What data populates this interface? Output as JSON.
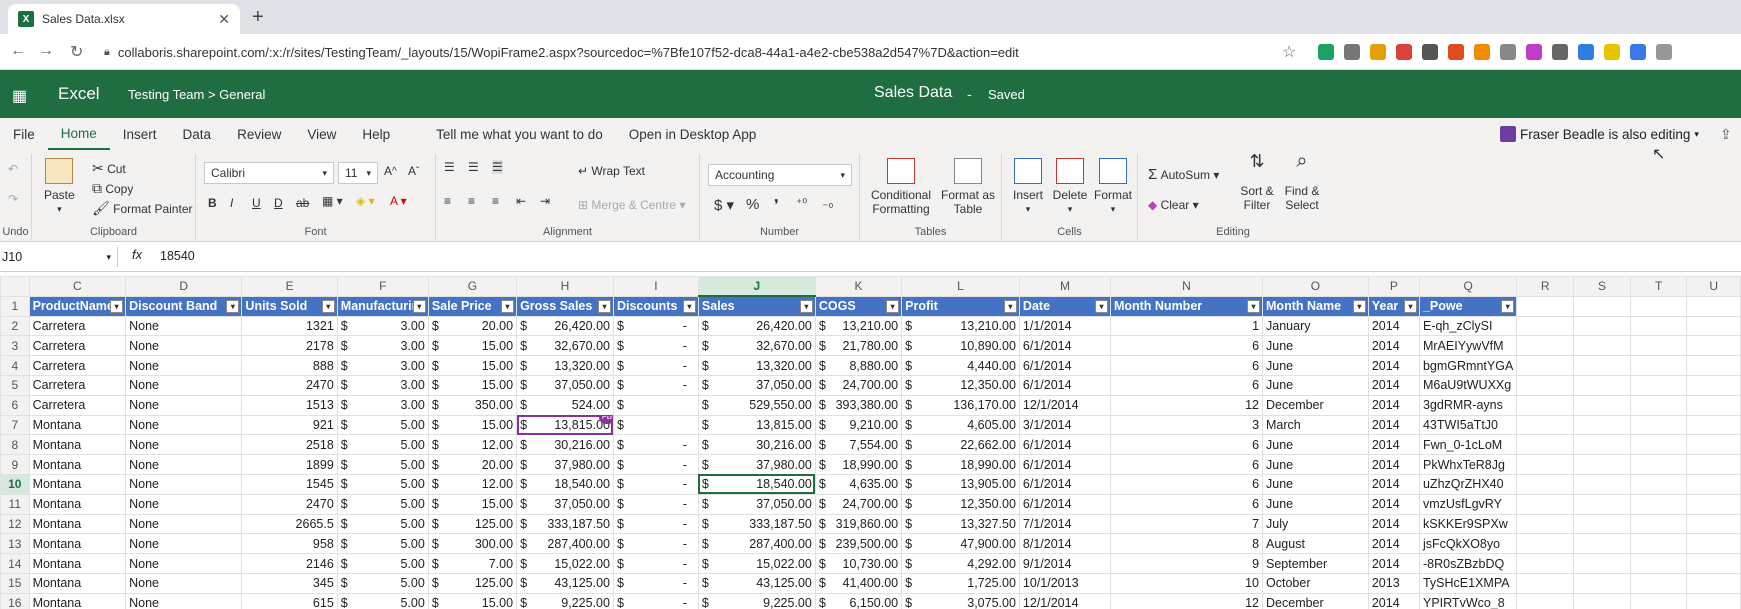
{
  "browser": {
    "tab_title": "Sales Data.xlsx",
    "tab_icon": "X",
    "url": "collaboris.sharepoint.com/:x:/r/sites/TestingTeam/_layouts/15/WopiFrame2.aspx?sourcedoc=%7Bfe107f52-dca8-44a1-a4e2-cbe538a2d547%7D&action=edit"
  },
  "excel": {
    "app_name": "Excel",
    "breadcrumb": "Testing Team  >  General",
    "doc_title": "Sales Data",
    "separator": "-",
    "status": "Saved",
    "tabs": [
      "File",
      "Home",
      "Insert",
      "Data",
      "Review",
      "View",
      "Help",
      "Tell me what you want to do",
      "Open in Desktop App"
    ],
    "coauthor": "Fraser Beadle is also editing"
  },
  "ribbon": {
    "undo_label": "Undo",
    "paste": "Paste",
    "cut": "Cut",
    "copy": "Copy",
    "format_painter": "Format Painter",
    "clipboard_label": "Clipboard",
    "font_name": "Calibri",
    "font_size": "11",
    "font_label": "Font",
    "wrap_text": "Wrap Text",
    "merge_centre": "Merge & Centre",
    "alignment_label": "Alignment",
    "number_format": "Accounting",
    "number_label": "Number",
    "conditional_formatting": "Conditional Formatting",
    "format_as_table": "Format as Table",
    "tables_label": "Tables",
    "insert": "Insert",
    "delete": "Delete",
    "format": "Format",
    "cells_label": "Cells",
    "autosum": "AutoSum",
    "clear": "Clear",
    "sort_filter": "Sort & Filter",
    "find_select": "Find & Select",
    "editing_label": "Editing"
  },
  "formula": {
    "name_box": "J10",
    "fx": "fx",
    "value": "18540"
  },
  "grid": {
    "columns": [
      "C",
      "D",
      "E",
      "F",
      "G",
      "H",
      "I",
      "J",
      "K",
      "L",
      "M",
      "N",
      "O",
      "P",
      "Q",
      "R",
      "S",
      "T",
      "U"
    ],
    "headers": [
      "ProductName",
      "Discount Band",
      "Units Sold",
      "Manufacturin",
      "Sale Price",
      "Gross Sales",
      "Discounts",
      "Sales",
      "COGS",
      "Profit",
      "Date",
      "Month Number",
      "Month Name",
      "Year",
      "_Powe"
    ],
    "rows": [
      {
        "n": "2",
        "c": [
          "Carretera",
          "None",
          "1321",
          "3.00",
          "20.00",
          "26,420.00",
          "-",
          "26,420.00",
          "13,210.00",
          "13,210.00",
          "1/1/2014",
          "1",
          "January",
          "2014",
          "E-qh_zClySI"
        ]
      },
      {
        "n": "3",
        "c": [
          "Carretera",
          "None",
          "2178",
          "3.00",
          "15.00",
          "32,670.00",
          "-",
          "32,670.00",
          "21,780.00",
          "10,890.00",
          "6/1/2014",
          "6",
          "June",
          "2014",
          "MrAEIYywVfM"
        ]
      },
      {
        "n": "4",
        "c": [
          "Carretera",
          "None",
          "888",
          "3.00",
          "15.00",
          "13,320.00",
          "-",
          "13,320.00",
          "8,880.00",
          "4,440.00",
          "6/1/2014",
          "6",
          "June",
          "2014",
          "bgmGRmntYGA"
        ]
      },
      {
        "n": "5",
        "c": [
          "Carretera",
          "None",
          "2470",
          "3.00",
          "15.00",
          "37,050.00",
          "-",
          "37,050.00",
          "24,700.00",
          "12,350.00",
          "6/1/2014",
          "6",
          "June",
          "2014",
          "M6aU9tWUXXg"
        ]
      },
      {
        "n": "6",
        "c": [
          "Carretera",
          "None",
          "1513",
          "3.00",
          "350.00",
          "524.00",
          "",
          "529,550.00",
          "393,380.00",
          "136,170.00",
          "12/1/2014",
          "12",
          "December",
          "2014",
          "3gdRMR-ayns"
        ]
      },
      {
        "n": "7",
        "c": [
          "Montana",
          "None",
          "921",
          "5.00",
          "15.00",
          "13,815.00",
          "",
          "13,815.00",
          "9,210.00",
          "4,605.00",
          "3/1/2014",
          "3",
          "March",
          "2014",
          "43TWI5aTtJ0"
        ]
      },
      {
        "n": "8",
        "c": [
          "Montana",
          "None",
          "2518",
          "5.00",
          "12.00",
          "30,216.00",
          "-",
          "30,216.00",
          "7,554.00",
          "22,662.00",
          "6/1/2014",
          "6",
          "June",
          "2014",
          "Fwn_0-1cLoM"
        ]
      },
      {
        "n": "9",
        "c": [
          "Montana",
          "None",
          "1899",
          "5.00",
          "20.00",
          "37,980.00",
          "-",
          "37,980.00",
          "18,990.00",
          "18,990.00",
          "6/1/2014",
          "6",
          "June",
          "2014",
          "PkWhxTeR8Jg"
        ]
      },
      {
        "n": "10",
        "c": [
          "Montana",
          "None",
          "1545",
          "5.00",
          "12.00",
          "18,540.00",
          "-",
          "18,540.00",
          "4,635.00",
          "13,905.00",
          "6/1/2014",
          "6",
          "June",
          "2014",
          "uZhzQrZHX40"
        ]
      },
      {
        "n": "11",
        "c": [
          "Montana",
          "None",
          "2470",
          "5.00",
          "15.00",
          "37,050.00",
          "-",
          "37,050.00",
          "24,700.00",
          "12,350.00",
          "6/1/2014",
          "6",
          "June",
          "2014",
          "vmzUsfLgvRY"
        ]
      },
      {
        "n": "12",
        "c": [
          "Montana",
          "None",
          "2665.5",
          "5.00",
          "125.00",
          "333,187.50",
          "-",
          "333,187.50",
          "319,860.00",
          "13,327.50",
          "7/1/2014",
          "7",
          "July",
          "2014",
          "kSKKEr9SPXw"
        ]
      },
      {
        "n": "13",
        "c": [
          "Montana",
          "None",
          "958",
          "5.00",
          "300.00",
          "287,400.00",
          "-",
          "287,400.00",
          "239,500.00",
          "47,900.00",
          "8/1/2014",
          "8",
          "August",
          "2014",
          "jsFcQkXO8yo"
        ]
      },
      {
        "n": "14",
        "c": [
          "Montana",
          "None",
          "2146",
          "5.00",
          "7.00",
          "15,022.00",
          "-",
          "15,022.00",
          "10,730.00",
          "4,292.00",
          "9/1/2014",
          "9",
          "September",
          "2014",
          "-8R0sZBzbDQ"
        ]
      },
      {
        "n": "15",
        "c": [
          "Montana",
          "None",
          "345",
          "5.00",
          "125.00",
          "43,125.00",
          "-",
          "43,125.00",
          "41,400.00",
          "1,725.00",
          "10/1/2013",
          "10",
          "October",
          "2013",
          "TySHcE1XMPA"
        ]
      },
      {
        "n": "16",
        "c": [
          "Montana",
          "None",
          "615",
          "5.00",
          "15.00",
          "9,225.00",
          "-",
          "9,225.00",
          "6,150.00",
          "3,075.00",
          "12/1/2014",
          "12",
          "December",
          "2014",
          "YPIRTvWco_8"
        ]
      }
    ],
    "coedit_tag": "FB"
  }
}
